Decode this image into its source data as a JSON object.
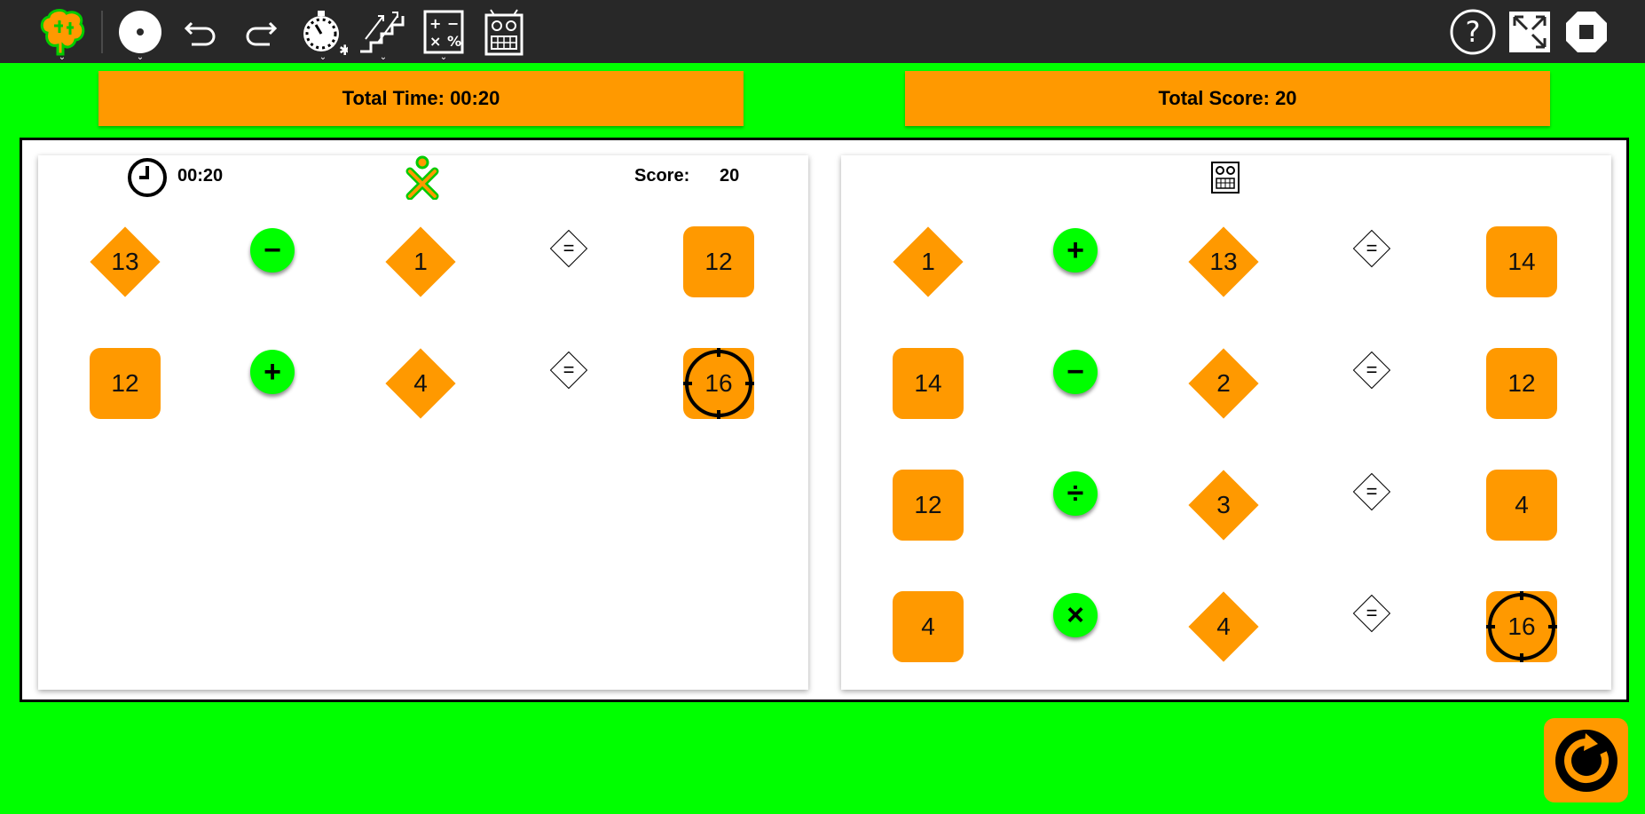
{
  "toolbar": {
    "left_icons": [
      "brain-icon",
      "disc-icon",
      "undo-icon",
      "redo-icon",
      "stopwatch-icon",
      "stairs-icon",
      "calculator-icon",
      "robot-icon"
    ],
    "right_icons": [
      "help-icon",
      "fullscreen-icon",
      "stop-icon"
    ]
  },
  "banners": {
    "total_time": "Total Time: 00:20",
    "total_score": "Total Score: 20"
  },
  "player_panel": {
    "time": "00:20",
    "score_label": "Score:",
    "score_value": "20",
    "rows": [
      {
        "a": "13",
        "a_shape": "diamond",
        "op": "−",
        "b": "1",
        "eq": "=",
        "result": "12",
        "result_target": false
      },
      {
        "a": "12",
        "a_shape": "square",
        "op": "+",
        "b": "4",
        "eq": "=",
        "result": "16",
        "result_target": true
      }
    ]
  },
  "robot_panel": {
    "rows": [
      {
        "a": "1",
        "a_shape": "diamond",
        "op": "+",
        "b": "13",
        "eq": "=",
        "result": "14",
        "result_target": false
      },
      {
        "a": "14",
        "a_shape": "square",
        "op": "−",
        "b": "2",
        "eq": "=",
        "result": "12",
        "result_target": false
      },
      {
        "a": "12",
        "a_shape": "square",
        "op": "÷",
        "b": "3",
        "eq": "=",
        "result": "4",
        "result_target": false
      },
      {
        "a": "4",
        "a_shape": "square",
        "op": "×",
        "b": "4",
        "eq": "=",
        "result": "16",
        "result_target": true
      }
    ]
  },
  "colors": {
    "background": "#00ff00",
    "toolbar": "#282828",
    "tile": "#ff9900",
    "operator": "#00ff00"
  }
}
